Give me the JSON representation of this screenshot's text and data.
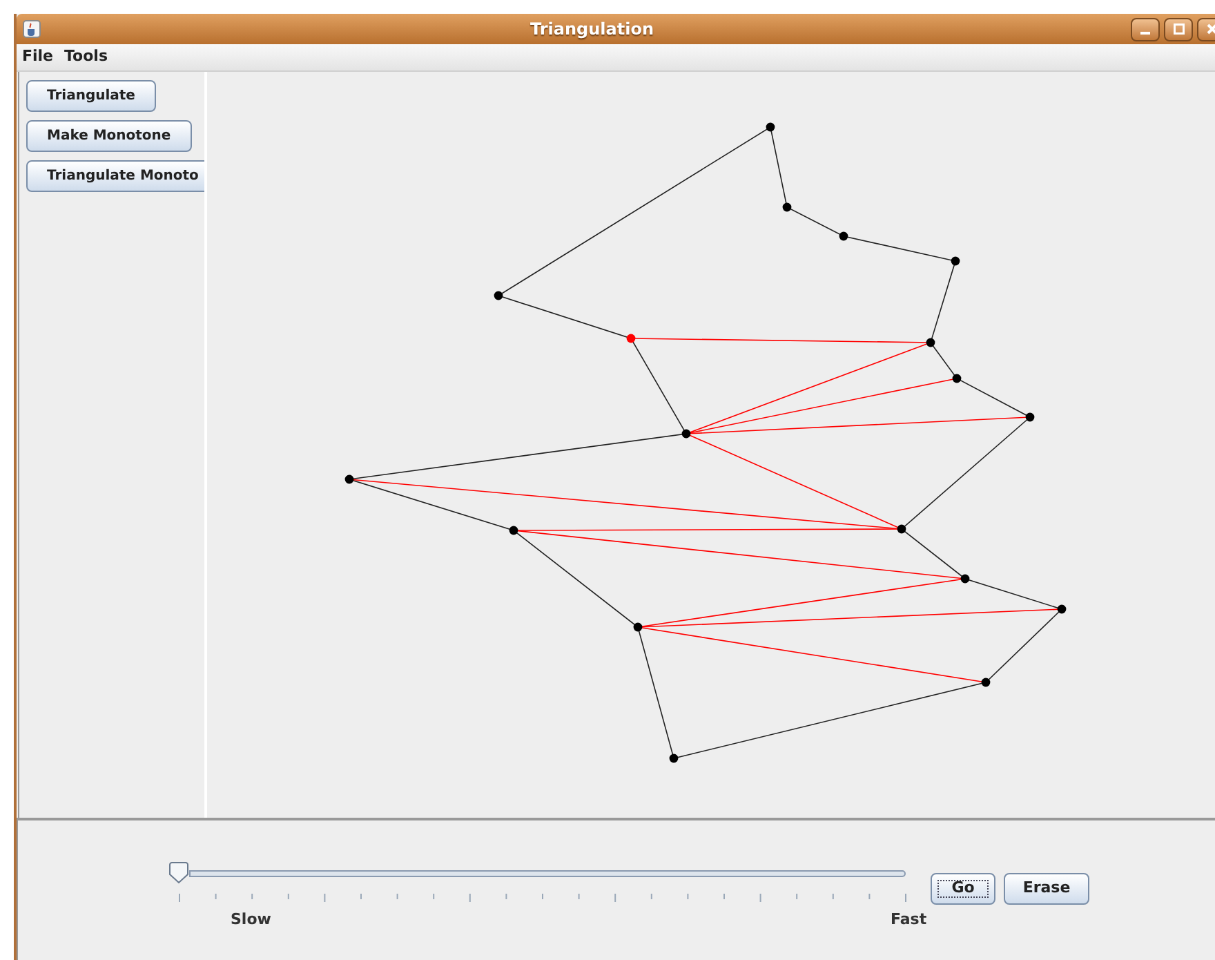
{
  "window": {
    "title": "Triangulation"
  },
  "menu": [
    "File",
    "Tools"
  ],
  "side_buttons": [
    "Triangulate",
    "Make Monotone",
    "Triangulate Monoto"
  ],
  "slider": {
    "level": 0,
    "min_label": "Slow",
    "max_label": "Fast"
  },
  "buttons": [
    {
      "label": "Go",
      "focused": true
    },
    {
      "label": "Erase",
      "focused": false
    }
  ]
}
